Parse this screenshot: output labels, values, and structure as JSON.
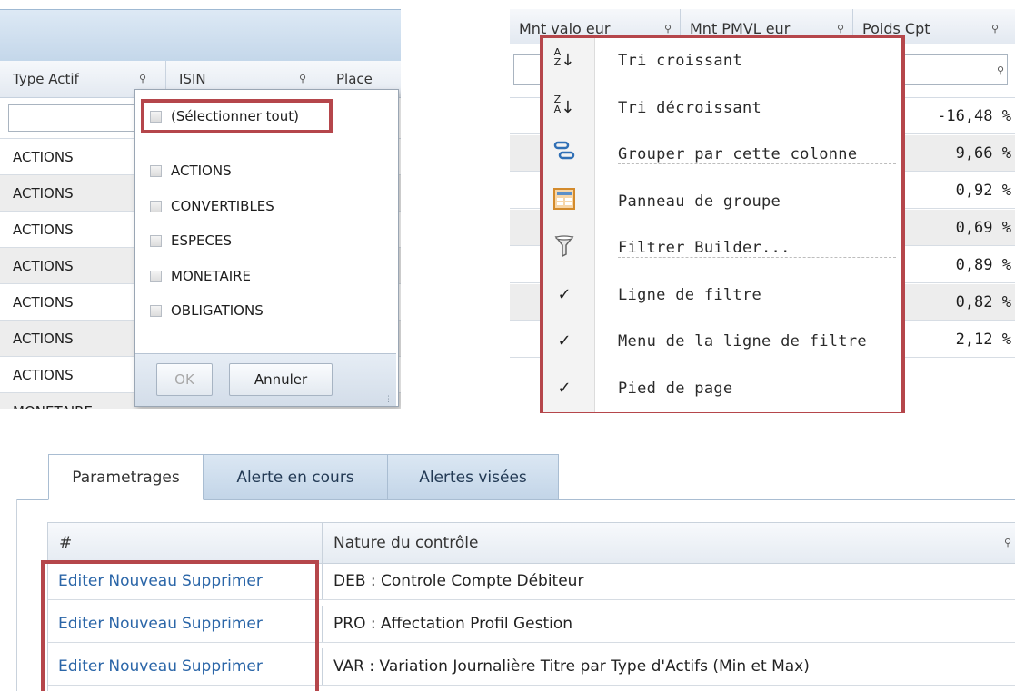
{
  "filter_panel": {
    "columns": [
      "Type Actif",
      "ISIN",
      "Place"
    ],
    "rows": [
      "ACTIONS",
      "ACTIONS",
      "ACTIONS",
      "ACTIONS",
      "ACTIONS",
      "ACTIONS",
      "ACTIONS",
      "MONETAIRE"
    ],
    "dropdown": {
      "select_all": "(Sélectionner tout)",
      "options": [
        "ACTIONS",
        "CONVERTIBLES",
        "ESPECES",
        "MONETAIRE",
        "OBLIGATIONS"
      ],
      "ok_label": "OK",
      "cancel_label": "Annuler"
    }
  },
  "context_panel": {
    "columns": [
      "Mnt valo eur",
      "Mnt PMVL eur",
      "Poids Cpt"
    ],
    "values": [
      "-16,48 %",
      "9,66 %",
      "0,92 %",
      "0,69 %",
      "0,89 %",
      "0,82 %",
      "2,12 %"
    ],
    "menu": [
      {
        "label": "Tri croissant",
        "icon": "sort-ascending-icon"
      },
      {
        "label": "Tri décroissant",
        "icon": "sort-descending-icon"
      },
      {
        "label": "Grouper par cette colonne",
        "icon": "group-by-column-icon"
      },
      {
        "label": "Panneau de groupe",
        "icon": "group-panel-icon"
      },
      {
        "label": "Filtrer Builder...",
        "icon": "filter-funnel-icon"
      },
      {
        "label": "Ligne de filtre",
        "icon": "checkmark-icon"
      },
      {
        "label": "Menu de la ligne de filtre",
        "icon": "checkmark-icon"
      },
      {
        "label": "Pied de page",
        "icon": "checkmark-icon"
      }
    ]
  },
  "alerts_panel": {
    "tabs": [
      "Parametrages",
      "Alerte en cours",
      "Alertes visées"
    ],
    "columns": [
      "#",
      "Nature du contrôle"
    ],
    "actions": [
      "Editer",
      "Nouveau",
      "Supprimer"
    ],
    "rows": [
      "DEB : Controle Compte Débiteur",
      "PRO : Affectation Profil Gestion",
      "VAR : Variation Journalière Titre par Type d'Actifs (Min et Max)"
    ]
  },
  "colors": {
    "highlight": "#b5464b",
    "link": "#2b66a8",
    "header_blue": "#c4d7ea"
  }
}
